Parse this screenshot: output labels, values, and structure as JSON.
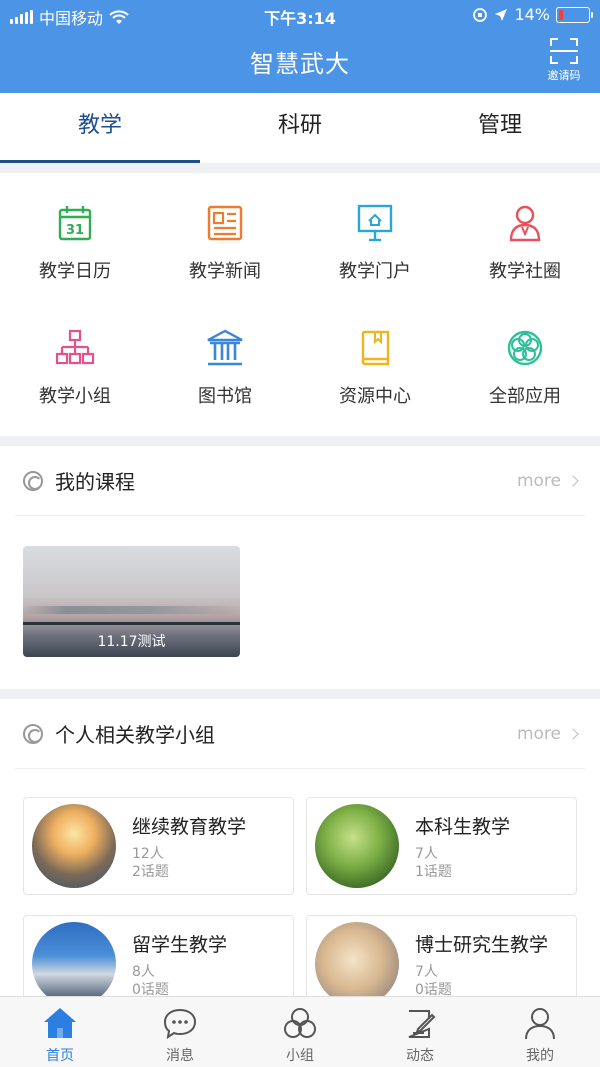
{
  "status_bar": {
    "carrier": "中国移动",
    "time": "下午3:14",
    "battery": "14%",
    "battery_level": 0.14
  },
  "header": {
    "title": "智慧武大",
    "invite_label": "邀请码"
  },
  "tabs": [
    {
      "label": "教学",
      "active": true
    },
    {
      "label": "科研",
      "active": false
    },
    {
      "label": "管理",
      "active": false
    }
  ],
  "apps": [
    {
      "label": "教学日历",
      "icon": "calendar-icon",
      "color": "#2fae52"
    },
    {
      "label": "教学新闻",
      "icon": "news-icon",
      "color": "#f07a2e"
    },
    {
      "label": "教学门户",
      "icon": "portal-icon",
      "color": "#2aa7d8"
    },
    {
      "label": "教学社圈",
      "icon": "community-icon",
      "color": "#e8505b"
    },
    {
      "label": "教学小组",
      "icon": "group-icon",
      "color": "#e8508c"
    },
    {
      "label": "图书馆",
      "icon": "library-icon",
      "color": "#3a86d8"
    },
    {
      "label": "资源中心",
      "icon": "book-icon",
      "color": "#f0b41e"
    },
    {
      "label": "全部应用",
      "icon": "all-apps-icon",
      "color": "#2fbf9a"
    }
  ],
  "calendar_day": "31",
  "courses_section": {
    "title": "我的课程",
    "more": "more",
    "items": [
      {
        "caption": "11.17测试"
      }
    ]
  },
  "groups_section": {
    "title": "个人相关教学小组",
    "more": "more",
    "items": [
      {
        "name": "继续教育教学",
        "members": "12人",
        "topics": "2话题"
      },
      {
        "name": "本科生教学",
        "members": "7人",
        "topics": "1话题"
      },
      {
        "name": "留学生教学",
        "members": "8人",
        "topics": "0话题"
      },
      {
        "name": "博士研究生教学",
        "members": "7人",
        "topics": "0话题"
      }
    ]
  },
  "bottom_nav": [
    {
      "label": "首页",
      "icon": "home-icon",
      "active": true
    },
    {
      "label": "消息",
      "icon": "message-icon",
      "active": false
    },
    {
      "label": "小组",
      "icon": "group-circles-icon",
      "active": false
    },
    {
      "label": "动态",
      "icon": "edit-icon",
      "active": false
    },
    {
      "label": "我的",
      "icon": "profile-icon",
      "active": false
    }
  ],
  "colors": {
    "primary": "#4c95e6",
    "tab_active": "#1e4f8c",
    "nav_active": "#2b7fe0"
  }
}
